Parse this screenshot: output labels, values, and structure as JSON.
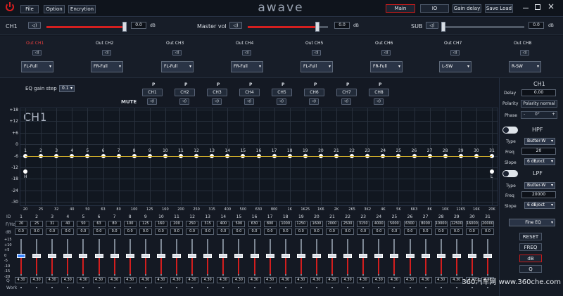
{
  "app": {
    "brand": "awave"
  },
  "menu": {
    "file": "File",
    "option": "Option",
    "encryption": "Encrytion"
  },
  "tabs": {
    "main": "Main",
    "io": "IO",
    "gain_delay": "Gain delay",
    "save_load": "Save Load"
  },
  "master": {
    "ch_label": "CH1",
    "ch_value": "0.0",
    "unit": "dB",
    "master_label": "Master vol",
    "master_value": "0.0",
    "sub_label": "SUB",
    "sub_value": "0.0"
  },
  "outs": [
    {
      "label": "Out CH1",
      "source": "FL-Full"
    },
    {
      "label": "Out CH2",
      "source": "FR-Full"
    },
    {
      "label": "Out CH3",
      "source": "FL-Full"
    },
    {
      "label": "Out CH4",
      "source": "FR-Full"
    },
    {
      "label": "Out CH5",
      "source": "FL-Full"
    },
    {
      "label": "Out CH6",
      "source": "FR-Full"
    },
    {
      "label": "Out CH7",
      "source": "L-SW"
    },
    {
      "label": "Out CH8",
      "source": "R-SW"
    }
  ],
  "eq_step": {
    "label": "EQ gain step",
    "value": "0.1"
  },
  "mute": "MUTE",
  "phase_marker": "P",
  "channels": [
    "CH1",
    "CH2",
    "CH3",
    "CH4",
    "CH5",
    "CH6",
    "CH7",
    "CH8"
  ],
  "graph": {
    "channel": "CH1",
    "yticks": [
      "+18",
      "+12",
      "+6",
      "0",
      "-6",
      "-12",
      "-18",
      "-24",
      "-30"
    ],
    "left_marker": "H",
    "right_marker": "L",
    "freq_labels": [
      "20",
      "25",
      "32",
      "40",
      "50",
      "63",
      "80",
      "100",
      "125",
      "160",
      "200",
      "250",
      "315",
      "400",
      "500",
      "630",
      "800",
      "1K",
      "1K25",
      "1K6",
      "2K",
      "2K5",
      "3K2",
      "4K",
      "5K",
      "6K3",
      "8K",
      "10K",
      "12K5",
      "16K",
      "20K"
    ]
  },
  "bands": {
    "ids": [
      "1",
      "2",
      "3",
      "4",
      "5",
      "6",
      "7",
      "8",
      "9",
      "10",
      "11",
      "12",
      "13",
      "14",
      "15",
      "16",
      "17",
      "18",
      "19",
      "20",
      "21",
      "22",
      "23",
      "24",
      "25",
      "26",
      "27",
      "28",
      "29",
      "30",
      "31"
    ],
    "freq": [
      "20",
      "25",
      "31",
      "40",
      "50",
      "63",
      "80",
      "100",
      "125",
      "160",
      "200",
      "250",
      "315",
      "400",
      "500",
      "630",
      "800",
      "1000",
      "1250",
      "1600",
      "2000",
      "2500",
      "3150",
      "4000",
      "5000",
      "6300",
      "8000",
      "10000",
      "12500",
      "16000",
      "20000"
    ],
    "db": "0.0",
    "q": "4.30",
    "slider_ticks": [
      "+15",
      "+10",
      "+5",
      "0",
      "-5",
      "-10",
      "-15",
      "-20"
    ]
  },
  "rows": {
    "id": "ID",
    "freq": "F/Hz",
    "db": "dB",
    "q": "Q",
    "work": "Work"
  },
  "right": {
    "title": "CH1",
    "delay_label": "Delay",
    "delay_value": "0.00",
    "polarity_label": "Polarity",
    "polarity_value": "Polarity normal",
    "phase_label": "Phase",
    "phase_value": "0°",
    "hpf": "HPF",
    "lpf": "LPF",
    "type_label": "Type",
    "freq_label": "Freq",
    "slope_label": "Slope",
    "hpf_type": "Butter-W",
    "hpf_freq": "20",
    "hpf_slope": "6 dB/oct",
    "lpf_type": "Butter-W",
    "lpf_freq": "20000",
    "lpf_slope": "6 dB/oct",
    "eq_mode": "Fine EQ",
    "reset": "RESET",
    "freq_btn": "FREQ",
    "db_btn": "dB",
    "q_btn": "Q"
  },
  "watermark": "360汽车网 www.360che.com"
}
